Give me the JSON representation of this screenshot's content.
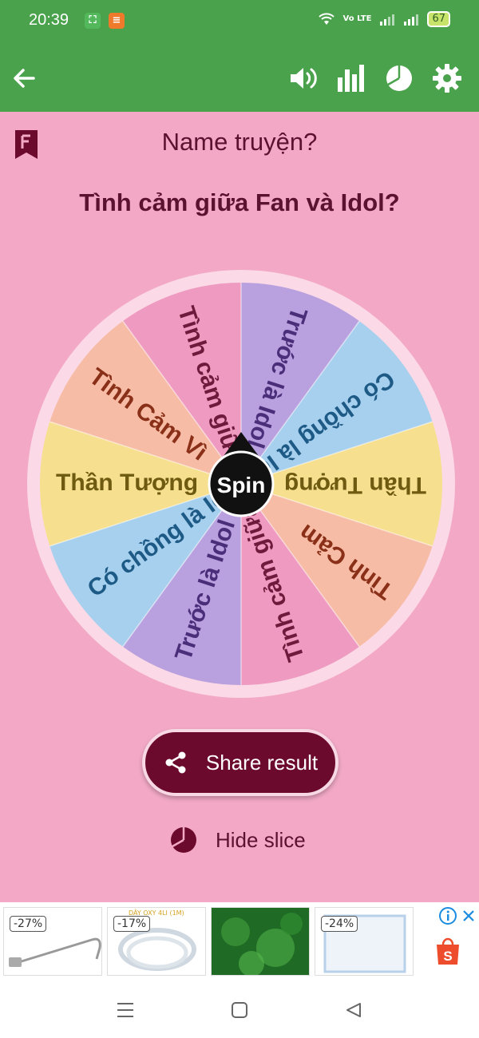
{
  "status_bar": {
    "time": "20:39",
    "network_label": "Vo LTE",
    "battery": "67"
  },
  "toolbar": {
    "back_icon": "arrow-left-icon",
    "sound_icon": "speaker-icon",
    "stats_icon": "bar-chart-icon",
    "slices_icon": "pie-icon",
    "settings_icon": "gear-icon"
  },
  "wheel": {
    "title": "Name truyện?",
    "question": "Tình cảm giữa Fan và Idol?",
    "spin_label": "Spin",
    "slices": [
      {
        "label": "Trước là Idol",
        "color": "#b9a0de"
      },
      {
        "label": "Có chồng là Idol",
        "color": "#a7d0ee"
      },
      {
        "label": "Thần Tượng",
        "color": "#f6df8e"
      },
      {
        "label": "Tình Cảm",
        "color": "#f7bca6"
      },
      {
        "label": "Tình cảm giữa",
        "color": "#ef9ac0"
      },
      {
        "label": "Trước là Idol",
        "color": "#b9a0de"
      },
      {
        "label": "Có chồng là Idol",
        "color": "#a7d0ee"
      },
      {
        "label": "Thần Tượng",
        "color": "#f6df8e"
      },
      {
        "label": "Tình Cảm Vì",
        "color": "#f7bca6"
      },
      {
        "label": "Tình cảm giữa",
        "color": "#ef9ac0"
      }
    ],
    "text_colors": {
      "#b9a0de": "#4a2e7a",
      "#a7d0ee": "#1e5a86",
      "#f6df8e": "#6e5a10",
      "#f7bca6": "#8a3018",
      "#ef9ac0": "#6e1a3c"
    }
  },
  "actions": {
    "share_label": "Share result",
    "hide_slice_label": "Hide slice"
  },
  "ad": {
    "items": [
      {
        "discount": "-27%",
        "caption": ""
      },
      {
        "discount": "-17%",
        "caption": "DÂY OXY 4LI (1M)"
      },
      {
        "discount": "",
        "caption": ""
      },
      {
        "discount": "-24%",
        "caption": ""
      }
    ]
  },
  "colors": {
    "toolbar": "#4aa24c",
    "background": "#f3a9c6",
    "primary_text": "#5b1130",
    "button": "#6c0a2d"
  }
}
